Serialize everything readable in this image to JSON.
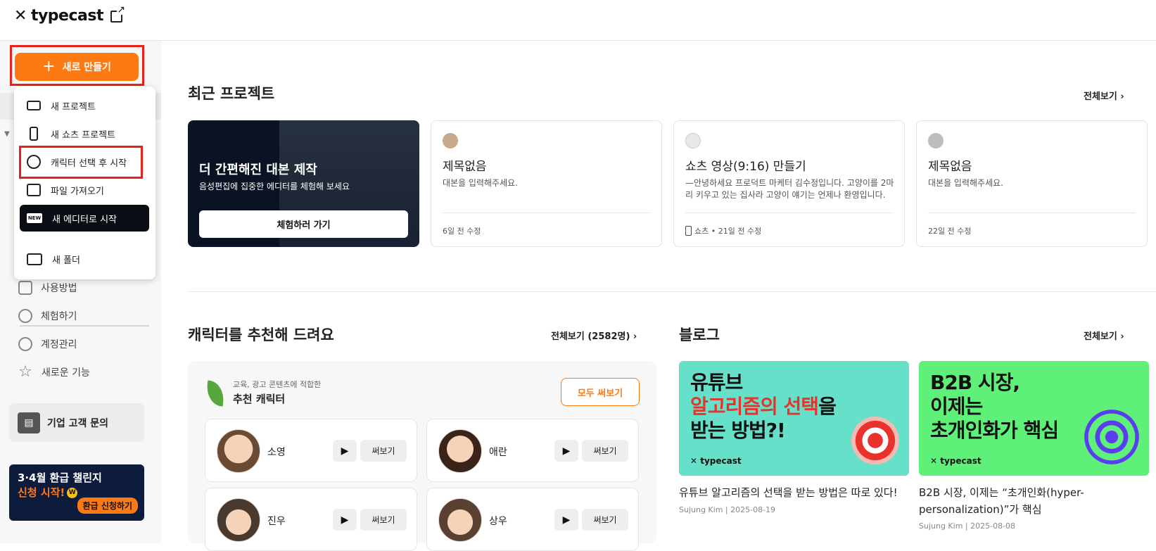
{
  "header": {
    "logo_mark": "✕",
    "logo_text": "typecast"
  },
  "sidebar": {
    "new_button": "새로 만들기",
    "items": [
      {
        "label": "사용방법",
        "icon": "video-guide-icon"
      },
      {
        "label": "체험하기",
        "icon": "hand-wave-icon"
      },
      {
        "label": "계정관리",
        "icon": "gear-icon"
      },
      {
        "label": "새로운 기능",
        "icon": "star-icon"
      }
    ],
    "business": {
      "label": "기업 고객 문의"
    },
    "promo": {
      "line1": "3·4월 환급 챌린지",
      "line2": "신청 시작!",
      "w": "W",
      "button": "환급 신청하기"
    }
  },
  "menu": {
    "items": [
      {
        "label": "새 프로젝트",
        "icon": "rectangle-icon"
      },
      {
        "label": "새 쇼츠 프로젝트",
        "icon": "phone-icon"
      },
      {
        "label": "캐릭터 선택 후 시작",
        "icon": "face-icon"
      },
      {
        "label": "파일 가져오기",
        "icon": "import-icon"
      },
      {
        "label": "새 에디터로 시작",
        "icon": "new-badge-icon",
        "badge": "NEW"
      },
      {
        "label": "새 폴더",
        "icon": "folder-icon"
      }
    ]
  },
  "recent": {
    "title": "최근 프로젝트",
    "view_all": "전체보기 ›",
    "promo": {
      "title": "더 간편해진 대본 제작",
      "subtitle": "음성편집에 집중한 에디터를 체험해 보세요",
      "button": "체험하러 가기"
    },
    "cards": [
      {
        "title": "제목없음",
        "desc": "대본을 입력해주세요.",
        "meta": "6일 전 수정",
        "shorts": false
      },
      {
        "title": "쇼츠 영상(9:16) 만들기",
        "desc": "—안녕하세요 프로덕트 마케터 김수정입니다. 고양이를 2마리 키우고 있는 집사라 고양이 얘기는 언제나 환영입니다. …",
        "meta": "쇼츠 • 21일 전 수정",
        "shorts": true
      },
      {
        "title": "제목없음",
        "desc": "대본을 입력해주세요.",
        "meta": "22일 전 수정",
        "shorts": false
      }
    ]
  },
  "characters": {
    "title": "캐릭터를 추천해 드려요",
    "view_all": "전체보기 (2582명) ›",
    "subtitle": "교육, 광고 콘텐츠에 적합한",
    "box_title": "추천 캐릭터",
    "use_all": "모두 써보기",
    "play": "▶",
    "try_label": "써보기",
    "list": [
      {
        "name": "소영"
      },
      {
        "name": "애란"
      },
      {
        "name": "진우"
      },
      {
        "name": "상우"
      }
    ]
  },
  "blog": {
    "title": "블로그",
    "view_all": "전체보기 ›",
    "posts": [
      {
        "thumb_l1": "유튜브",
        "thumb_l2": "알고리즘의 선택",
        "thumb_l2b": "을",
        "thumb_l3": "받는 방법?!",
        "thumb_logo": "✕ typecast",
        "title": "유튜브 알고리즘의 선택을 받는 방법은 따로 있다!",
        "meta": "Sujung Kim | 2025-08-19",
        "color": "#66e0c9"
      },
      {
        "thumb_l1": "B2B 시장,",
        "thumb_l2": "이제는",
        "thumb_l3": "초개인화",
        "thumb_l3b": "가 핵심",
        "thumb_logo": "✕ typecast",
        "title": "B2B 시장, 이제는 “초개인화(hyper-personalization)”가 핵심",
        "meta": "Sujung Kim | 2025-08-08",
        "color": "#5ff07a"
      }
    ]
  },
  "colors": {
    "accent": "#fb7a14",
    "highlight": "#e8221a"
  }
}
